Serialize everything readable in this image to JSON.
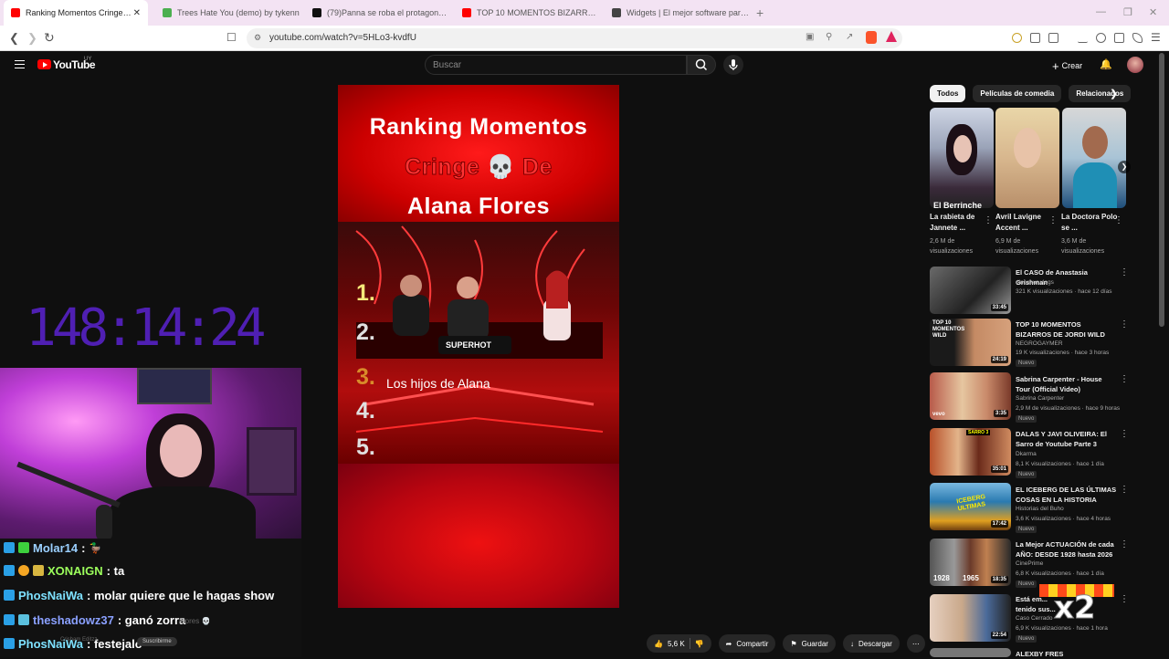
{
  "browser": {
    "tabs": [
      {
        "label": "Ranking Momentos Cringe De A",
        "color": "#ff0000"
      },
      {
        "label": "Trees Hate You (demo) by tykenn",
        "color": "#4caf50"
      },
      {
        "label": "(79)Panna se roba el protagonismo",
        "color": "#111111"
      },
      {
        "label": "TOP 10 MOMENTOS BIZARROS DE",
        "color": "#ff0000"
      },
      {
        "label": "Widgets | El mejor software para por",
        "color": "#444444"
      }
    ],
    "new_tab": "+",
    "close_tab": "✕",
    "url": "youtube.com/watch?v=5HLo3-kvdfU"
  },
  "yt": {
    "logo_text": "YouTube",
    "country": "UY",
    "search_placeholder": "Buscar",
    "create_label": "Crear"
  },
  "video": {
    "title_lines": [
      "Ranking Momentos",
      "Cringe",
      "De",
      "Alana Flores"
    ],
    "skull": "💀",
    "ranks": [
      "1.",
      "2.",
      "3.",
      "4.",
      "5."
    ],
    "rank3_text": "Los hijos de Alana",
    "sign": "SUPERHOT",
    "watermark_name": "Cringe",
    "watermark_text": "Momentos",
    "watermark_text2": "Flores 💀"
  },
  "actions": {
    "likes": "5,6 K",
    "share": "Compartir",
    "save": "Guardar",
    "download": "Descargar"
  },
  "stream": {
    "timer": "148:14:24",
    "chat": [
      {
        "user": "Molar14",
        "user_color": "#9bd0ff",
        "msg": ":",
        "badge": "#2aa0e6"
      },
      {
        "user": "XONAIGN",
        "user_color": "#9cff5c",
        "msg": ": ta",
        "badge": "#2aa0e6"
      },
      {
        "user": "PhosNaiWa",
        "user_color": "#7ee1ff",
        "msg": ": molar quiere que le hagas show",
        "badge": "#2aa0e6"
      },
      {
        "user": "theshadowz37",
        "user_color": "#8aa0ff",
        "msg": ": ganó zorra",
        "badge": "#2aa0e6"
      },
      {
        "user": "PhosNaiWa",
        "user_color": "#7ee1ff",
        "msg": ": festejalo",
        "badge": "#2aa0e6"
      }
    ],
    "overlay_label": "Suscribirme",
    "overlay_channel": "Crisham Editzz"
  },
  "sidebar": {
    "chips": [
      "Todos",
      "Películas de comedia",
      "Relacionados"
    ],
    "shorts": [
      {
        "title": "La rabieta de Jannete ...",
        "views": "2,6 M de visualizaciones",
        "overlay": "El Berrinche"
      },
      {
        "title": "Avril Lavigne Accent ...",
        "views": "6,9 M de visualizaciones"
      },
      {
        "title": "La Doctora Polo se ...",
        "views": "3,6 M de visualizaciones"
      }
    ],
    "videos": [
      {
        "title": "El CASO de Anastasia Grishman",
        "channel": "dinosaur vlogs",
        "meta": "321 K visualizaciones · hace 12 días",
        "duration": "33:45",
        "new": ""
      },
      {
        "title": "TOP 10 MOMENTOS BIZARROS DE JORDI WILD",
        "channel": "NEGROGAYMER",
        "meta": "19 K visualizaciones · hace 3 horas",
        "duration": "24:19",
        "new": "Nuevo",
        "thumb_text": "TOP 10 MOMENTOS WILD"
      },
      {
        "title": "Sabrina Carpenter - House Tour (Official Video)",
        "channel": "Sabrina Carpenter",
        "meta": "2,9 M de visualizaciones · hace 9 horas",
        "duration": "3:35",
        "new": "Nuevo",
        "thumb_text": "vevo"
      },
      {
        "title": "DALAS Y JAVI OLIVEIRA: El Sarro de Youtube Parte 3",
        "channel": "Dkarma",
        "meta": "8,1 K visualizaciones · hace 1 día",
        "duration": "35:01",
        "new": "Nuevo",
        "thumb_text": "SARRO 3"
      },
      {
        "title": "EL ICEBERG DE LAS ÚLTIMAS COSAS EN LA HISTORIA",
        "channel": "Historias del Buho",
        "meta": "3,6 K visualizaciones · hace 4 horas",
        "duration": "17:42",
        "new": "Nuevo",
        "thumb_text": "ICEBERG ULTIMAS"
      },
      {
        "title": "La Mejor ACTUACIÓN de cada AÑO: DESDE 1928 hasta 2026",
        "channel": "CinePrime",
        "meta": "6,8 K visualizaciones · hace 1 día",
        "duration": "18:35",
        "new": "Nuevo",
        "thumb_text": "1928",
        "thumb_text2": "1965"
      },
      {
        "title": "Está em... tenido sus...",
        "channel": "Caso Cerrado",
        "meta": "6,9 K visualizaciones · hace 1 hora",
        "duration": "22:54",
        "new": "Nuevo"
      },
      {
        "title": "ALEXBY FRES",
        "channel": "",
        "meta": "",
        "duration": "",
        "new": ""
      }
    ]
  },
  "overlays": {
    "x2": "x2"
  }
}
